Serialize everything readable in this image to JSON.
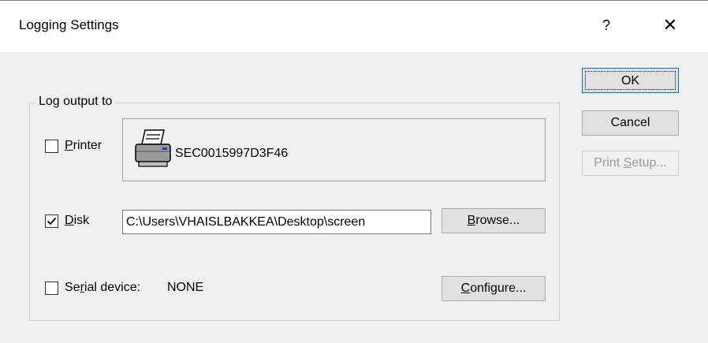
{
  "window": {
    "title": "Logging Settings",
    "help_glyph": "?",
    "close_glyph": "✕"
  },
  "buttons": {
    "ok": "OK",
    "cancel": "Cancel",
    "print_setup_prefix": "Print ",
    "print_setup_underlined": "S",
    "print_setup_suffix": "etup..."
  },
  "group": {
    "label": "Log output to",
    "printer": {
      "checked": false,
      "label_underlined": "P",
      "label_rest": "rinter",
      "device_name": "SEC0015997D3F46",
      "icon": "printer-icon"
    },
    "disk": {
      "checked": true,
      "label_underlined": "D",
      "label_rest": "isk",
      "path": "C:\\Users\\VHAISLBAKKEA\\Desktop\\screen",
      "browse_underlined": "B",
      "browse_rest": "rowse..."
    },
    "serial": {
      "checked": false,
      "label_prefix": "Se",
      "label_underlined": "r",
      "label_rest": "ial device:",
      "device": "NONE",
      "configure_underlined": "C",
      "configure_rest": "onfigure..."
    }
  }
}
